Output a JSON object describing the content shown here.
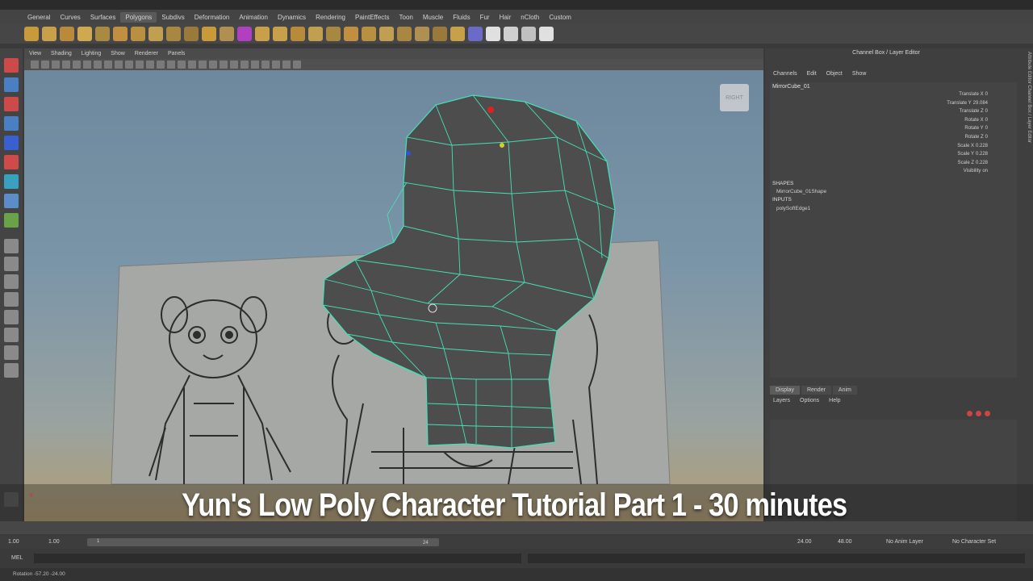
{
  "menu_tabs": [
    "General",
    "Curves",
    "Surfaces",
    "Polygons",
    "Subdivs",
    "Deformation",
    "Animation",
    "Dynamics",
    "Rendering",
    "PaintEffects",
    "Toon",
    "Muscle",
    "Fluids",
    "Fur",
    "Hair",
    "nCloth",
    "Custom"
  ],
  "active_menu_tab_index": 3,
  "viewport": {
    "menu": [
      "View",
      "Shading",
      "Lighting",
      "Show",
      "Renderer",
      "Panels"
    ],
    "view_cube_label": "RIGHT",
    "wire_color": "#45e0b6",
    "mesh_color": "#4b4b4b"
  },
  "channel_box": {
    "title": "Channel Box / Layer Editor",
    "menu": [
      "Channels",
      "Edit",
      "Object",
      "Show"
    ],
    "object_name": "MirrorCube_01",
    "attributes": [
      {
        "label": "Translate X",
        "value": "0"
      },
      {
        "label": "Translate Y",
        "value": "29.084"
      },
      {
        "label": "Translate Z",
        "value": "0"
      },
      {
        "label": "Rotate X",
        "value": "0"
      },
      {
        "label": "Rotate Y",
        "value": "0"
      },
      {
        "label": "Rotate Z",
        "value": "0"
      },
      {
        "label": "Scale X",
        "value": "0.228"
      },
      {
        "label": "Scale Y",
        "value": "0.228"
      },
      {
        "label": "Scale Z",
        "value": "0.228"
      },
      {
        "label": "Visibility",
        "value": "on"
      }
    ],
    "shapes_header": "SHAPES",
    "shape_name": "MirrorCube_01Shape",
    "inputs_header": "INPUTS",
    "input_name": "polySoftEdge1",
    "side_tabs": "Attribute Editor    Channel Box / Layer Editor"
  },
  "layer_editor": {
    "tabs": [
      "Display",
      "Render",
      "Anim"
    ],
    "active_tab_index": 0,
    "menu": [
      "Layers",
      "Options",
      "Help"
    ]
  },
  "overlay_title": "Yun's Low Poly Character Tutorial Part 1 - 30 minutes",
  "range": {
    "start": "1.00",
    "inner_start": "1.00",
    "current": "1",
    "inner_end": "24",
    "end": "24.00",
    "outer_end": "48.00",
    "anim_layer": "No Anim Layer",
    "character_set": "No Character Set"
  },
  "mel_label": "MEL",
  "status": "Rotation   -57.20   -24.00"
}
